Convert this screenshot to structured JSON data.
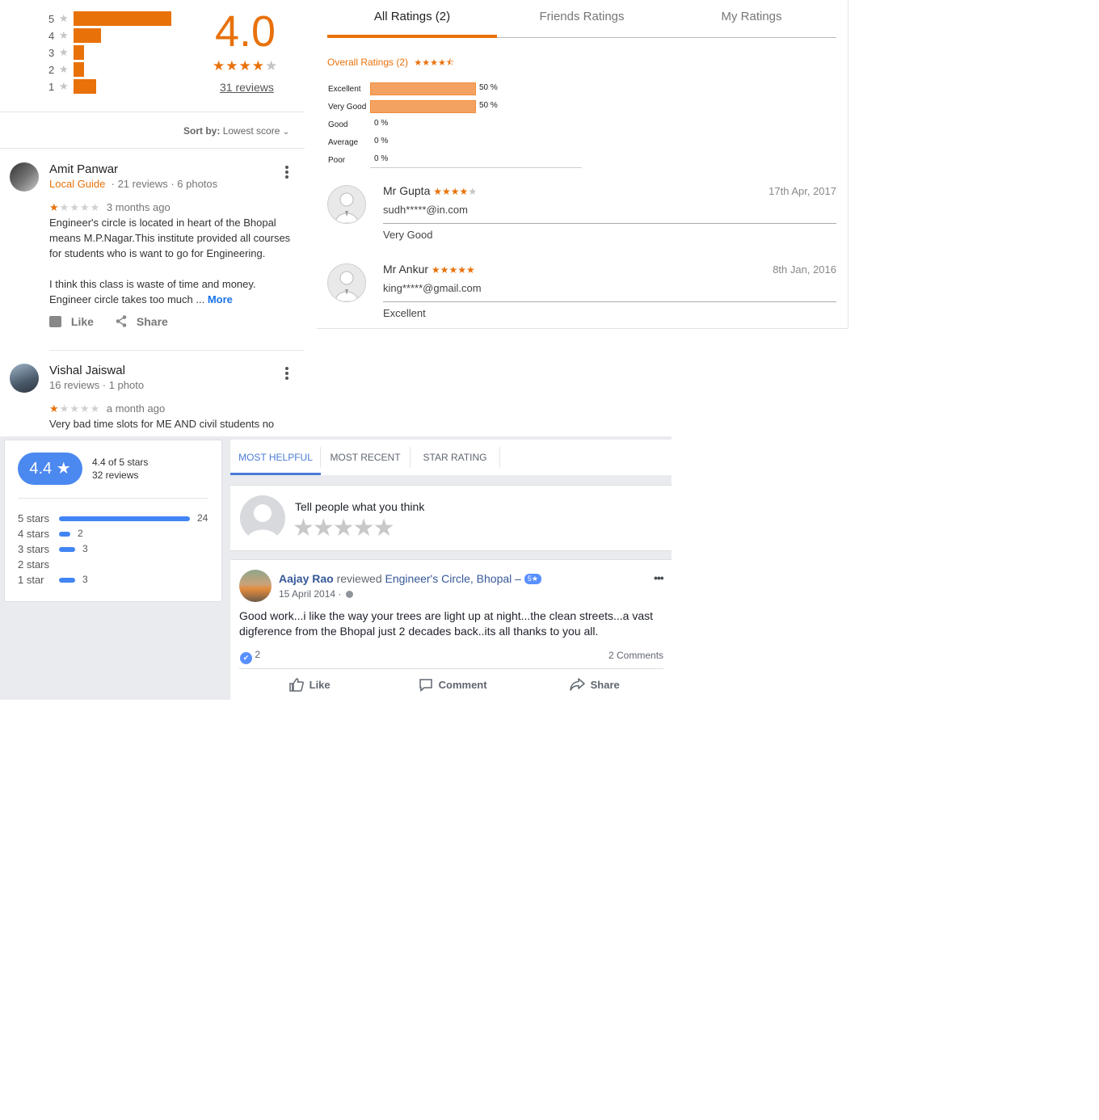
{
  "google_summary": {
    "average": "4.0",
    "reviews_link": "31 reviews",
    "rating_stars": 4,
    "distribution": [
      {
        "label": "5",
        "fraction": 1.0
      },
      {
        "label": "4",
        "fraction": 0.28
      },
      {
        "label": "3",
        "fraction": 0.11
      },
      {
        "label": "2",
        "fraction": 0.11
      },
      {
        "label": "1",
        "fraction": 0.23
      }
    ],
    "sort_label": "Sort by:",
    "sort_value": "Lowest score"
  },
  "google_reviews": [
    {
      "name": "Amit Panwar",
      "badge": "Local Guide",
      "meta": "21 reviews · 6 photos",
      "stars": 1,
      "time": "3 months ago",
      "text1": "Engineer's circle is located in heart of the Bhopal means M.P.Nagar.This institute provided all courses for students who is want to go for Engineering.",
      "text2": "I think this class is waste of time and money. Engineer circle takes too much ...",
      "more": "More",
      "like": "Like",
      "share": "Share"
    },
    {
      "name": "Vishal Jaiswal",
      "meta": "16 reviews · 1 photo",
      "stars": 1,
      "time": "a month ago",
      "text1": "Very bad time slots for ME AND civil students no"
    }
  ],
  "ratings_panel": {
    "tabs": [
      "All Ratings (2)",
      "Friends Ratings",
      "My Ratings"
    ],
    "overall_label": "Overall Ratings (2)",
    "overall_stars": 4.5,
    "breakdown": [
      {
        "label": "Excellent",
        "pct": "50 %",
        "fraction": 0.5
      },
      {
        "label": "Very Good",
        "pct": "50 %",
        "fraction": 0.5
      },
      {
        "label": "Good",
        "pct": "0 %",
        "fraction": 0
      },
      {
        "label": "Average",
        "pct": "0 %",
        "fraction": 0
      },
      {
        "label": "Poor",
        "pct": "0 %",
        "fraction": 0
      }
    ],
    "reviews": [
      {
        "name": "Mr Gupta",
        "stars": 4,
        "date": "17th Apr, 2017",
        "email": "sudh*****@in.com",
        "rating_text": "Very Good"
      },
      {
        "name": "Mr Ankur",
        "stars": 5,
        "date": "8th Jan, 2016",
        "email": "king*****@gmail.com",
        "rating_text": "Excellent"
      }
    ]
  },
  "fb_summary": {
    "badge": "4.4 ★",
    "of_stars": "4.4 of 5 stars",
    "reviews": "32 reviews",
    "rows": [
      {
        "label": "5 stars",
        "count": "24",
        "fraction": 1.0
      },
      {
        "label": "4 stars",
        "count": "2",
        "fraction": 0.083
      },
      {
        "label": "3 stars",
        "count": "3",
        "fraction": 0.125
      },
      {
        "label": "2 stars",
        "count": "",
        "fraction": 0
      },
      {
        "label": "1 star",
        "count": "3",
        "fraction": 0.125
      }
    ]
  },
  "fb_tabs": [
    "MOST HELPFUL",
    "MOST RECENT",
    "STAR RATING"
  ],
  "fb_compose": {
    "prompt": "Tell people what you think"
  },
  "fb_post": {
    "author": "Aajay Rao",
    "verb": "reviewed",
    "page": "Engineer's Circle, Bhopal",
    "dash": "–",
    "rating_badge": "5★",
    "date": "15 April 2014 ·",
    "text": "Good work...i like the way your trees are light up at night...the clean streets...a vast digference from the Bhopal just 2 decades back..its all thanks to you all.",
    "likes": "2",
    "comments": "2 Comments",
    "like": "Like",
    "comment": "Comment",
    "share": "Share"
  },
  "colors": {
    "google_orange": "#e8710a",
    "zomato_bar": "#f4a261",
    "fb_blue": "#4267b2",
    "google_blue": "#4285f4"
  }
}
